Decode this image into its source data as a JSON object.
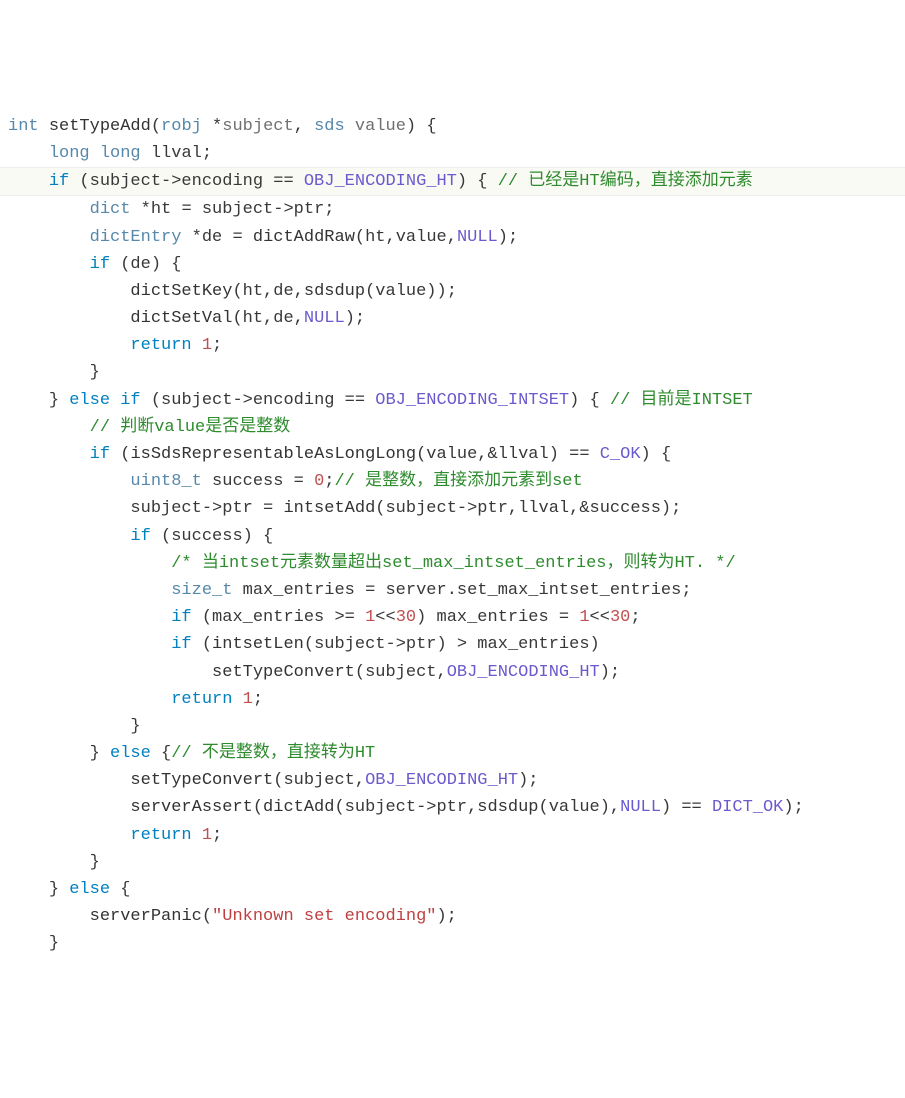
{
  "code": {
    "lines": [
      {
        "indent": 0,
        "highlight": false,
        "segments": [
          {
            "cls": "type",
            "t": "int"
          },
          {
            "cls": "",
            "t": " "
          },
          {
            "cls": "func",
            "t": "setTypeAdd"
          },
          {
            "cls": "",
            "t": "("
          },
          {
            "cls": "type",
            "t": "robj"
          },
          {
            "cls": "",
            "t": " *"
          },
          {
            "cls": "param",
            "t": "subject"
          },
          {
            "cls": "",
            "t": ", "
          },
          {
            "cls": "type",
            "t": "sds"
          },
          {
            "cls": "",
            "t": " "
          },
          {
            "cls": "param",
            "t": "value"
          },
          {
            "cls": "",
            "t": ") {"
          }
        ]
      },
      {
        "indent": 1,
        "highlight": false,
        "segments": [
          {
            "cls": "type",
            "t": "long"
          },
          {
            "cls": "",
            "t": " "
          },
          {
            "cls": "type",
            "t": "long"
          },
          {
            "cls": "",
            "t": " llval;"
          }
        ]
      },
      {
        "indent": 1,
        "highlight": true,
        "segments": [
          {
            "cls": "kw",
            "t": "if"
          },
          {
            "cls": "",
            "t": " (subject->encoding == "
          },
          {
            "cls": "const",
            "t": "OBJ_ENCODING_HT"
          },
          {
            "cls": "",
            "t": ") { "
          },
          {
            "cls": "comment",
            "t": "// 已经是HT编码，直接添加元素"
          }
        ]
      },
      {
        "indent": 2,
        "highlight": false,
        "segments": [
          {
            "cls": "type",
            "t": "dict"
          },
          {
            "cls": "",
            "t": " *ht = subject->ptr;"
          }
        ]
      },
      {
        "indent": 2,
        "highlight": false,
        "segments": [
          {
            "cls": "type",
            "t": "dictEntry"
          },
          {
            "cls": "",
            "t": " *de = "
          },
          {
            "cls": "func",
            "t": "dictAddRaw"
          },
          {
            "cls": "",
            "t": "(ht,value,"
          },
          {
            "cls": "const",
            "t": "NULL"
          },
          {
            "cls": "",
            "t": ");"
          }
        ]
      },
      {
        "indent": 2,
        "highlight": false,
        "segments": [
          {
            "cls": "kw",
            "t": "if"
          },
          {
            "cls": "",
            "t": " (de) {"
          }
        ]
      },
      {
        "indent": 3,
        "highlight": false,
        "segments": [
          {
            "cls": "func",
            "t": "dictSetKey"
          },
          {
            "cls": "",
            "t": "(ht,de,"
          },
          {
            "cls": "func",
            "t": "sdsdup"
          },
          {
            "cls": "",
            "t": "(value));"
          }
        ]
      },
      {
        "indent": 3,
        "highlight": false,
        "segments": [
          {
            "cls": "func",
            "t": "dictSetVal"
          },
          {
            "cls": "",
            "t": "(ht,de,"
          },
          {
            "cls": "const",
            "t": "NULL"
          },
          {
            "cls": "",
            "t": ");"
          }
        ]
      },
      {
        "indent": 3,
        "highlight": false,
        "segments": [
          {
            "cls": "kw",
            "t": "return"
          },
          {
            "cls": "",
            "t": " "
          },
          {
            "cls": "num",
            "t": "1"
          },
          {
            "cls": "",
            "t": ";"
          }
        ]
      },
      {
        "indent": 2,
        "highlight": false,
        "segments": [
          {
            "cls": "",
            "t": "}"
          }
        ]
      },
      {
        "indent": 1,
        "highlight": false,
        "segments": [
          {
            "cls": "",
            "t": "} "
          },
          {
            "cls": "kw",
            "t": "else"
          },
          {
            "cls": "",
            "t": " "
          },
          {
            "cls": "kw",
            "t": "if"
          },
          {
            "cls": "",
            "t": " (subject->encoding == "
          },
          {
            "cls": "const",
            "t": "OBJ_ENCODING_INTSET"
          },
          {
            "cls": "",
            "t": ") { "
          },
          {
            "cls": "comment",
            "t": "// 目前是INTSET"
          }
        ]
      },
      {
        "indent": 2,
        "highlight": false,
        "segments": [
          {
            "cls": "comment",
            "t": "// 判断value是否是整数"
          }
        ]
      },
      {
        "indent": 2,
        "highlight": false,
        "segments": [
          {
            "cls": "kw",
            "t": "if"
          },
          {
            "cls": "",
            "t": " ("
          },
          {
            "cls": "func",
            "t": "isSdsRepresentableAsLongLong"
          },
          {
            "cls": "",
            "t": "(value,&llval) == "
          },
          {
            "cls": "const",
            "t": "C_OK"
          },
          {
            "cls": "",
            "t": ") {"
          }
        ]
      },
      {
        "indent": 3,
        "highlight": false,
        "segments": [
          {
            "cls": "type",
            "t": "uint8_t"
          },
          {
            "cls": "",
            "t": " success = "
          },
          {
            "cls": "num",
            "t": "0"
          },
          {
            "cls": "",
            "t": ";"
          },
          {
            "cls": "comment",
            "t": "// 是整数，直接添加元素到set"
          }
        ]
      },
      {
        "indent": 3,
        "highlight": false,
        "segments": [
          {
            "cls": "",
            "t": "subject->ptr = "
          },
          {
            "cls": "func",
            "t": "intsetAdd"
          },
          {
            "cls": "",
            "t": "(subject->ptr,llval,&success);"
          }
        ]
      },
      {
        "indent": 3,
        "highlight": false,
        "segments": [
          {
            "cls": "kw",
            "t": "if"
          },
          {
            "cls": "",
            "t": " (success) {"
          }
        ]
      },
      {
        "indent": 4,
        "highlight": false,
        "segments": [
          {
            "cls": "comment",
            "t": "/* 当intset元素数量超出set_max_intset_entries，则转为HT. */"
          }
        ]
      },
      {
        "indent": 4,
        "highlight": false,
        "segments": [
          {
            "cls": "type",
            "t": "size_t"
          },
          {
            "cls": "",
            "t": " max_entries = server.set_max_intset_entries;"
          }
        ]
      },
      {
        "indent": 4,
        "highlight": false,
        "segments": [
          {
            "cls": "kw",
            "t": "if"
          },
          {
            "cls": "",
            "t": " (max_entries >= "
          },
          {
            "cls": "num",
            "t": "1"
          },
          {
            "cls": "",
            "t": "<<"
          },
          {
            "cls": "num",
            "t": "30"
          },
          {
            "cls": "",
            "t": ") max_entries = "
          },
          {
            "cls": "num",
            "t": "1"
          },
          {
            "cls": "",
            "t": "<<"
          },
          {
            "cls": "num",
            "t": "30"
          },
          {
            "cls": "",
            "t": ";"
          }
        ]
      },
      {
        "indent": 4,
        "highlight": false,
        "segments": [
          {
            "cls": "kw",
            "t": "if"
          },
          {
            "cls": "",
            "t": " ("
          },
          {
            "cls": "func",
            "t": "intsetLen"
          },
          {
            "cls": "",
            "t": "(subject->ptr) > max_entries)"
          }
        ]
      },
      {
        "indent": 5,
        "highlight": false,
        "segments": [
          {
            "cls": "func",
            "t": "setTypeConvert"
          },
          {
            "cls": "",
            "t": "(subject,"
          },
          {
            "cls": "const",
            "t": "OBJ_ENCODING_HT"
          },
          {
            "cls": "",
            "t": ");"
          }
        ]
      },
      {
        "indent": 4,
        "highlight": false,
        "segments": [
          {
            "cls": "kw",
            "t": "return"
          },
          {
            "cls": "",
            "t": " "
          },
          {
            "cls": "num",
            "t": "1"
          },
          {
            "cls": "",
            "t": ";"
          }
        ]
      },
      {
        "indent": 3,
        "highlight": false,
        "segments": [
          {
            "cls": "",
            "t": "}"
          }
        ]
      },
      {
        "indent": 2,
        "highlight": false,
        "segments": [
          {
            "cls": "",
            "t": "} "
          },
          {
            "cls": "kw",
            "t": "else"
          },
          {
            "cls": "",
            "t": " {"
          },
          {
            "cls": "comment",
            "t": "// 不是整数，直接转为HT"
          }
        ]
      },
      {
        "indent": 3,
        "highlight": false,
        "segments": [
          {
            "cls": "func",
            "t": "setTypeConvert"
          },
          {
            "cls": "",
            "t": "(subject,"
          },
          {
            "cls": "const",
            "t": "OBJ_ENCODING_HT"
          },
          {
            "cls": "",
            "t": ");"
          }
        ]
      },
      {
        "indent": 3,
        "highlight": false,
        "segments": [
          {
            "cls": "func",
            "t": "serverAssert"
          },
          {
            "cls": "",
            "t": "("
          },
          {
            "cls": "func",
            "t": "dictAdd"
          },
          {
            "cls": "",
            "t": "(subject->ptr,"
          },
          {
            "cls": "func",
            "t": "sdsdup"
          },
          {
            "cls": "",
            "t": "(value),"
          },
          {
            "cls": "const",
            "t": "NULL"
          },
          {
            "cls": "",
            "t": ") == "
          },
          {
            "cls": "const",
            "t": "DICT_OK"
          },
          {
            "cls": "",
            "t": ");"
          }
        ]
      },
      {
        "indent": 3,
        "highlight": false,
        "segments": [
          {
            "cls": "kw",
            "t": "return"
          },
          {
            "cls": "",
            "t": " "
          },
          {
            "cls": "num",
            "t": "1"
          },
          {
            "cls": "",
            "t": ";"
          }
        ]
      },
      {
        "indent": 2,
        "highlight": false,
        "segments": [
          {
            "cls": "",
            "t": "}"
          }
        ]
      },
      {
        "indent": 1,
        "highlight": false,
        "segments": [
          {
            "cls": "",
            "t": "} "
          },
          {
            "cls": "kw",
            "t": "else"
          },
          {
            "cls": "",
            "t": " {"
          }
        ]
      },
      {
        "indent": 2,
        "highlight": false,
        "segments": [
          {
            "cls": "func",
            "t": "serverPanic"
          },
          {
            "cls": "",
            "t": "("
          },
          {
            "cls": "str",
            "t": "\"Unknown set encoding\""
          },
          {
            "cls": "",
            "t": ");"
          }
        ]
      },
      {
        "indent": 1,
        "highlight": false,
        "segments": [
          {
            "cls": "",
            "t": "}"
          }
        ]
      }
    ],
    "indent_unit": "    "
  }
}
